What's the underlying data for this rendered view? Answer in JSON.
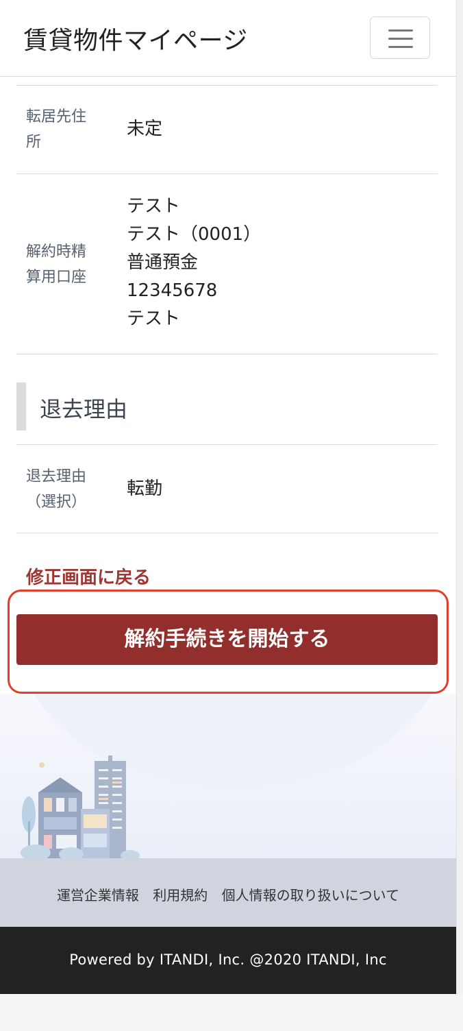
{
  "header": {
    "brand": "賃貸物件マイページ",
    "menu_button_icon": "hamburger-icon"
  },
  "details": [
    {
      "label_lines": [
        "転居先住",
        "所"
      ],
      "value_lines": [
        "未定"
      ]
    },
    {
      "label_lines": [
        "解約時精",
        "算用口座"
      ],
      "value_lines": [
        "テスト",
        "テスト（0001）",
        "普通預金",
        "12345678",
        "テスト"
      ]
    }
  ],
  "reason_section": {
    "title": "退去理由",
    "rows": [
      {
        "label_lines": [
          "退去理由",
          "（選択）"
        ],
        "value_lines": [
          "転勤"
        ]
      }
    ]
  },
  "actions": {
    "back_link": "修正画面に戻る",
    "submit_button": "解約手続きを開始する"
  },
  "footer": {
    "links": [
      "運営企業情報",
      "利用規約",
      "個人情報の取り扱いについて"
    ],
    "copyright": "Powered by ITANDI, Inc. @2020 ITANDI, Inc"
  },
  "colors": {
    "primary": "#922f2c",
    "link": "#a0362f",
    "highlight": "#e43d2a",
    "footer_dark": "#222222",
    "footer_links_bg": "#cfd4de"
  }
}
